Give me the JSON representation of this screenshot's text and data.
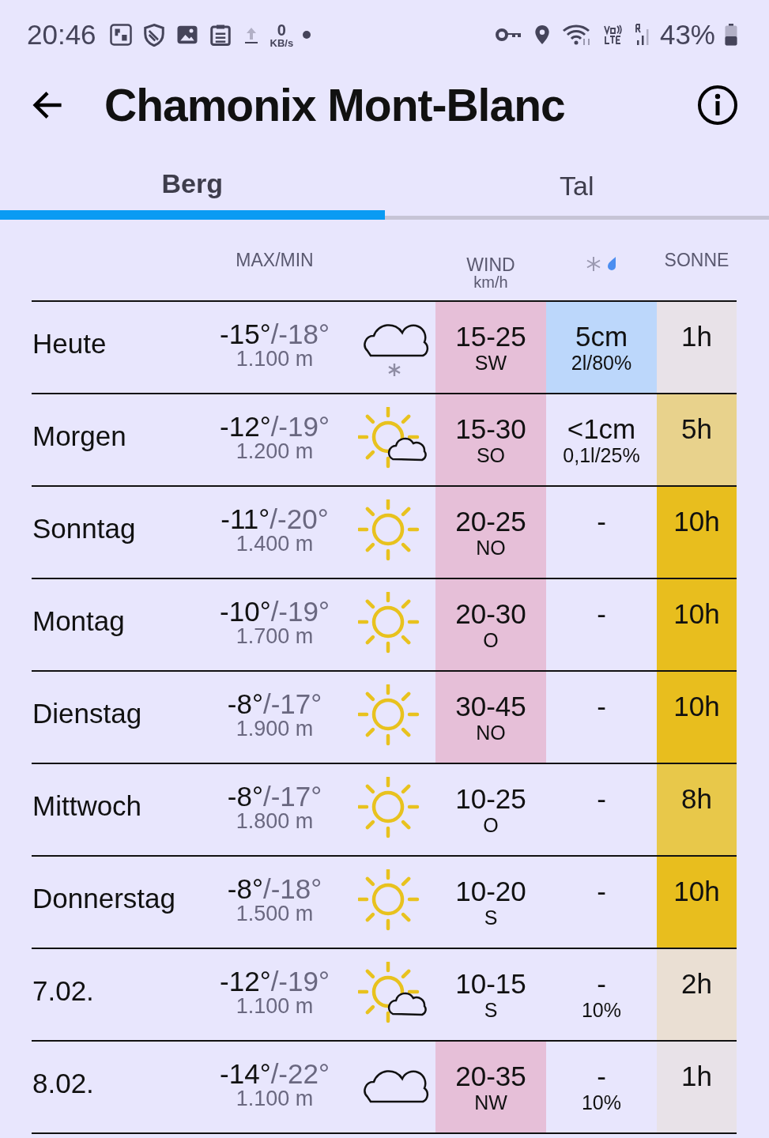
{
  "status_bar": {
    "time": "20:46",
    "speed_value": "0",
    "speed_unit": "KB/s",
    "battery": "43%"
  },
  "header": {
    "title": "Chamonix Mont-Blanc"
  },
  "tabs": [
    {
      "label": "Berg",
      "selected": true
    },
    {
      "label": "Tal",
      "selected": false
    }
  ],
  "table": {
    "columns": [
      {
        "kind": "text",
        "label": "MAX/MIN"
      },
      {
        "kind": "two-line",
        "label": "WIND",
        "sublabel": "km/h"
      },
      {
        "kind": "icons"
      },
      {
        "kind": "text",
        "label": "SONNE"
      }
    ],
    "rows": [
      {
        "day": "Heute",
        "max": "-15°",
        "min": "/-18°",
        "altitude": "1.100 m",
        "weather": {
          "kind": "snow-cloud"
        },
        "wind": {
          "range": "15-25",
          "direction": "SW",
          "color": "#e6bfd8"
        },
        "precip": {
          "amount": "5cm",
          "detail": "2l/80%",
          "color": "#bcd7fb"
        },
        "sun": {
          "hours": "1h",
          "color": "#e8e2e8"
        }
      },
      {
        "day": "Morgen",
        "max": "-12°",
        "min": "/-19°",
        "altitude": "1.200 m",
        "weather": {
          "kind": "sun-cloud"
        },
        "wind": {
          "range": "15-30",
          "direction": "SO",
          "color": "#e6bfd8"
        },
        "precip": {
          "amount": "<1cm",
          "detail": "0,1l/25%",
          "color": "#e8e6fd"
        },
        "sun": {
          "hours": "5h",
          "color": "#e8d28c"
        }
      },
      {
        "day": "Sonntag",
        "max": "-11°",
        "min": "/-20°",
        "altitude": "1.400 m",
        "weather": {
          "kind": "sun"
        },
        "wind": {
          "range": "20-25",
          "direction": "NO",
          "color": "#e6bfd8"
        },
        "precip": {
          "amount": "-",
          "color": "#e8e6fd"
        },
        "sun": {
          "hours": "10h",
          "color": "#e8be1e"
        }
      },
      {
        "day": "Montag",
        "max": "-10°",
        "min": "/-19°",
        "altitude": "1.700 m",
        "weather": {
          "kind": "sun"
        },
        "wind": {
          "range": "20-30",
          "direction": "O",
          "color": "#e6bfd8"
        },
        "precip": {
          "amount": "-",
          "color": "#e8e6fd"
        },
        "sun": {
          "hours": "10h",
          "color": "#e8be1e"
        }
      },
      {
        "day": "Dienstag",
        "max": "-8°",
        "min": "/-17°",
        "altitude": "1.900 m",
        "weather": {
          "kind": "sun"
        },
        "wind": {
          "range": "30-45",
          "direction": "NO",
          "color": "#e6bfd8"
        },
        "precip": {
          "amount": "-",
          "color": "#e8e6fd"
        },
        "sun": {
          "hours": "10h",
          "color": "#e8be1e"
        }
      },
      {
        "day": "Mittwoch",
        "max": "-8°",
        "min": "/-17°",
        "altitude": "1.800 m",
        "weather": {
          "kind": "sun"
        },
        "wind": {
          "range": "10-25",
          "direction": "O",
          "color": "#e8e6fd"
        },
        "precip": {
          "amount": "-",
          "color": "#e8e6fd"
        },
        "sun": {
          "hours": "8h",
          "color": "#e8c84a"
        }
      },
      {
        "day": "Donnerstag",
        "max": "-8°",
        "min": "/-18°",
        "altitude": "1.500 m",
        "weather": {
          "kind": "sun"
        },
        "wind": {
          "range": "10-20",
          "direction": "S",
          "color": "#e8e6fd"
        },
        "precip": {
          "amount": "-",
          "color": "#e8e6fd"
        },
        "sun": {
          "hours": "10h",
          "color": "#e8be1e"
        }
      },
      {
        "day": "7.02.",
        "max": "-12°",
        "min": "/-19°",
        "altitude": "1.100 m",
        "weather": {
          "kind": "sun-cloud"
        },
        "wind": {
          "range": "10-15",
          "direction": "S",
          "color": "#e8e6fd"
        },
        "precip": {
          "amount": "-",
          "detail": "10%",
          "color": "#e8e6fd"
        },
        "sun": {
          "hours": "2h",
          "color": "#eadfd3"
        }
      },
      {
        "day": "8.02.",
        "max": "-14°",
        "min": "/-22°",
        "altitude": "1.100 m",
        "weather": {
          "kind": "cloud"
        },
        "wind": {
          "range": "20-35",
          "direction": "NW",
          "color": "#e6bfd8"
        },
        "precip": {
          "amount": "-",
          "detail": "10%",
          "color": "#e8e6fd"
        },
        "sun": {
          "hours": "1h",
          "color": "#e8e2e8"
        }
      }
    ]
  }
}
